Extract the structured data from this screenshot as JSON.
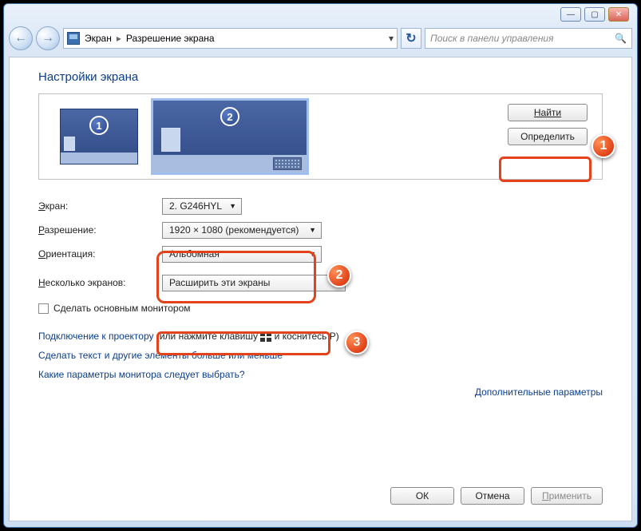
{
  "titlebar": {
    "min": "—",
    "max": "▢",
    "close": "✕"
  },
  "nav": {
    "back": "←",
    "fwd": "→"
  },
  "breadcrumb": {
    "root": "Экран",
    "current": "Разрешение экрана"
  },
  "search": {
    "placeholder": "Поиск в панели управления"
  },
  "heading": "Настройки экрана",
  "monitors": {
    "m1": "1",
    "m2": "2"
  },
  "buttons": {
    "find": "Найти",
    "identify": "Определить",
    "ok": "ОК",
    "cancel": "Отмена",
    "apply": "Применить"
  },
  "labels": {
    "screen": "Экран:",
    "resolution": "Разрешение:",
    "orientation": "Ориентация:",
    "multi": "Несколько экранов:",
    "make_main": "Сделать основным монитором",
    "advanced": "Дополнительные параметры"
  },
  "values": {
    "screen": "2. G246HYL",
    "resolution": "1920 × 1080 (рекомендуется)",
    "orientation": "Альбомная",
    "multi": "Расширить эти экраны"
  },
  "links": {
    "projector_a": "Подключение к проектору",
    "projector_b": " (или нажмите клавишу ",
    "projector_c": " и коснитесь P)",
    "textsize": "Сделать текст и другие элементы больше или меньше",
    "which": "Какие параметры монитора следует выбрать?"
  },
  "markers": {
    "m1": "1",
    "m2": "2",
    "m3": "3"
  }
}
